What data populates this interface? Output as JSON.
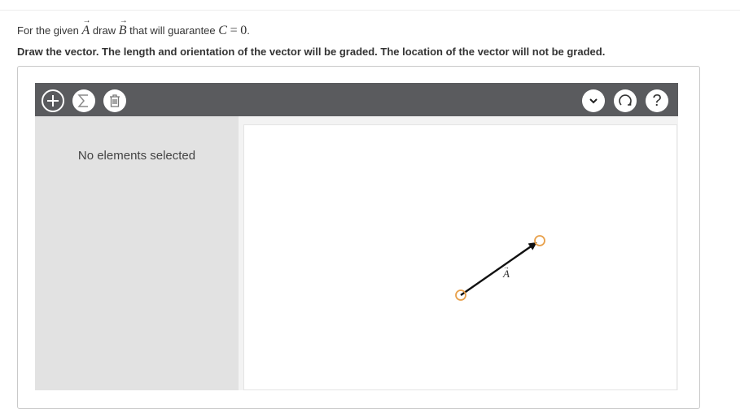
{
  "question": {
    "prefix": "For the given",
    "vector_a": "A",
    "draw": "draw",
    "vector_b": "B",
    "suffix": "that will guarantee",
    "c_symbol": "C",
    "equals": "=",
    "zero": "0",
    "period": "."
  },
  "instruction": "Draw the vector. The length and orientation of the vector will be graded. The location of the vector will not be graded.",
  "toolbar": {
    "add_icon": "plus-icon",
    "sum_icon": "sigma-icon",
    "delete_icon": "trash-icon",
    "dropdown_icon": "chevron-down-icon",
    "reset_icon": "reset-icon",
    "help_label": "?"
  },
  "sidebar": {
    "message": "No elements selected"
  },
  "canvas": {
    "vector_label": "A",
    "handle_color": "#e8a04a",
    "arrow_color": "#111111"
  }
}
